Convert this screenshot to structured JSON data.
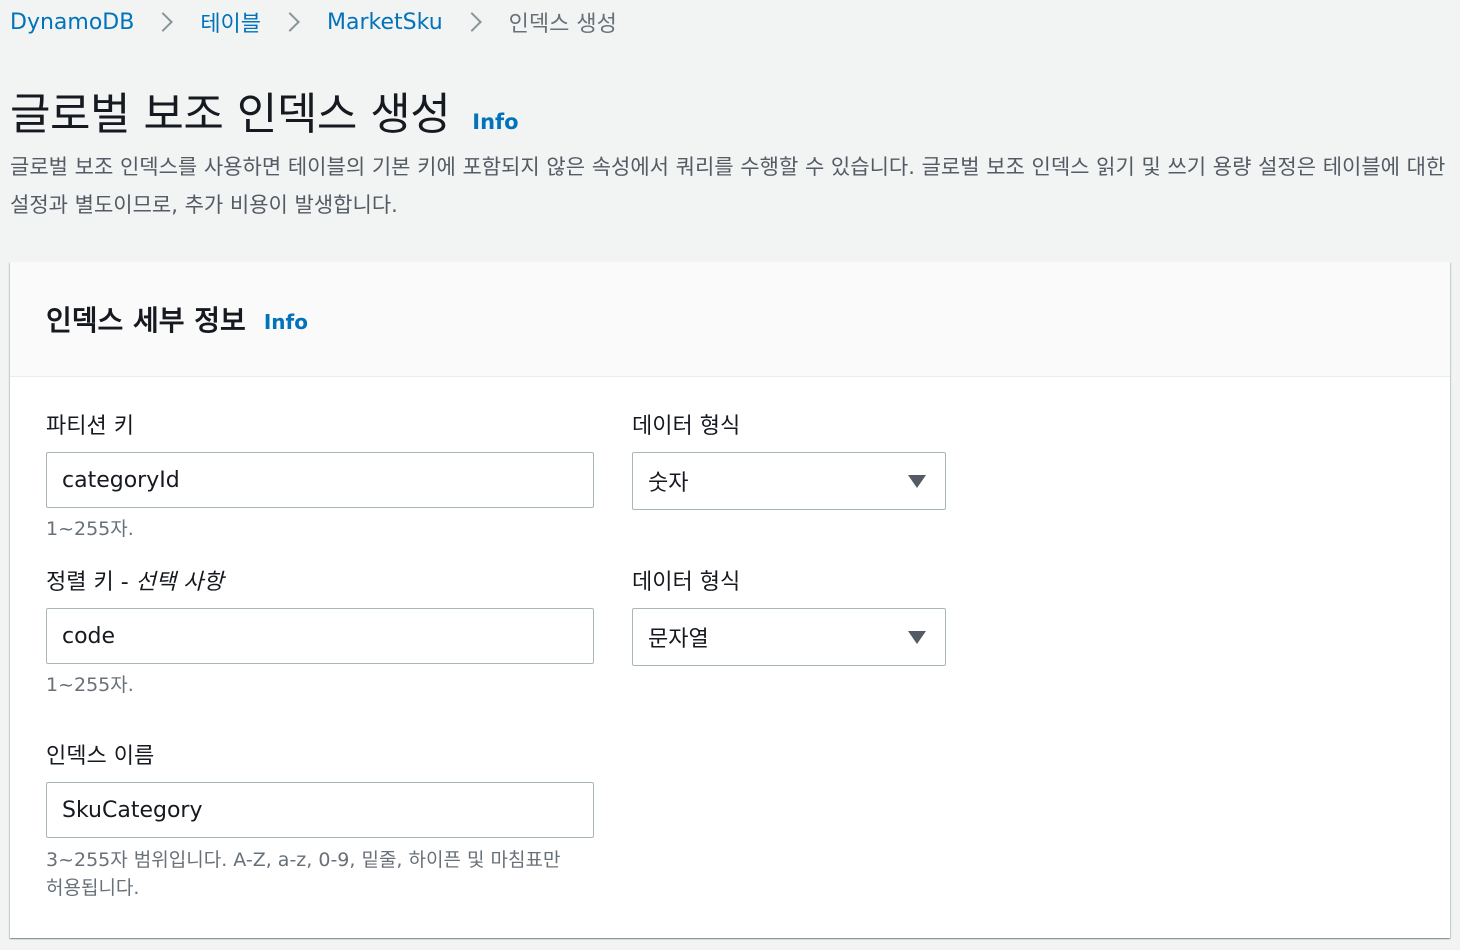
{
  "breadcrumb": {
    "items": [
      "DynamoDB",
      "테이블",
      "MarketSku"
    ],
    "current": "인덱스 생성"
  },
  "page": {
    "title": "글로벌 보조 인덱스 생성",
    "info_label": "Info",
    "description": "글로벌 보조 인덱스를 사용하면 테이블의 기본 키에 포함되지 않은 속성에서 쿼리를 수행할 수 있습니다. 글로벌 보조 인덱스 읽기 및 쓰기 용량 설정은 테이블에 대한 설정과 별도이므로, 추가 비용이 발생합니다."
  },
  "panel": {
    "title": "인덱스 세부 정보",
    "info_label": "Info",
    "partition_key": {
      "label": "파티션 키",
      "value": "categoryId",
      "hint": "1~255자."
    },
    "partition_type": {
      "label": "데이터 형식",
      "value": "숫자"
    },
    "sort_key": {
      "label": "정렬 키 - ",
      "label_optional": "선택 사항",
      "value": "code",
      "hint": "1~255자."
    },
    "sort_type": {
      "label": "데이터 형식",
      "value": "문자열"
    },
    "index_name": {
      "label": "인덱스 이름",
      "value": "SkuCategory",
      "hint_line1": "3~255자 범위입니다. A-Z, a-z, 0-9, 밑줄, 하이픈 및 마침표만",
      "hint_line2": "허용됩니다."
    }
  },
  "icons": {
    "breadcrumb_separator": "chevron-right-icon",
    "select_caret": "caret-down-icon"
  },
  "colors": {
    "link": "#0073bb",
    "background": "#f2f3f3",
    "text": "#16191f",
    "muted": "#687078"
  }
}
